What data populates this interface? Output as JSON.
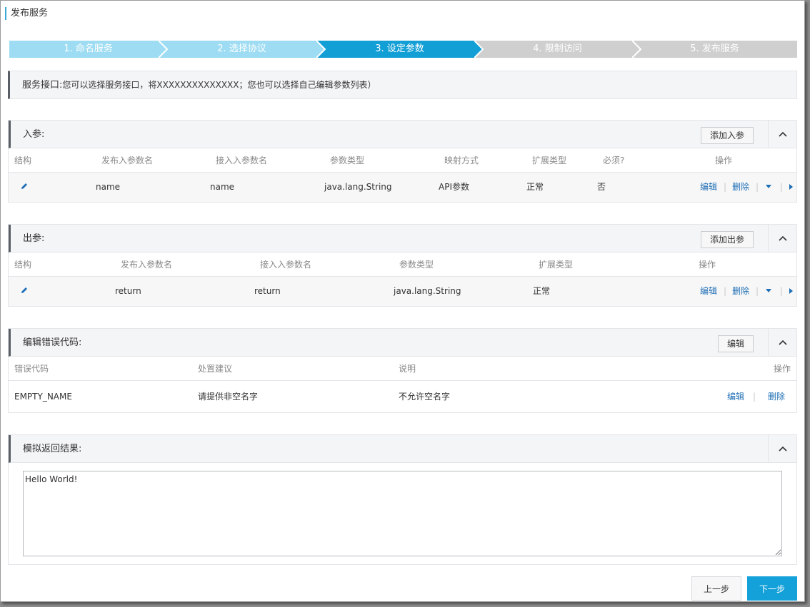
{
  "page_title": "发布服务",
  "steps": [
    {
      "label": "1. 命名服务",
      "state": "done"
    },
    {
      "label": "2. 选择协议",
      "state": "done"
    },
    {
      "label": "3. 设定参数",
      "state": "active"
    },
    {
      "label": "4. 限制访问",
      "state": "todo"
    },
    {
      "label": "5. 发布服务",
      "state": "todo"
    }
  ],
  "info": {
    "label": "服务接口:",
    "text": "您可以选择服务接口，将XXXXXXXXXXXXXX；您也可以选择自己编辑参数列表）"
  },
  "input_params": {
    "title": "入参:",
    "add_button": "添加入参",
    "columns": [
      "结构",
      "发布入参数名",
      "接入入参数名",
      "参数类型",
      "映射方式",
      "扩展类型",
      "必须?",
      "操作"
    ],
    "rows": [
      {
        "publish_name": "name",
        "access_name": "name",
        "type": "java.lang.String",
        "mapping": "API参数",
        "ext_type": "正常",
        "required": "否",
        "edit": "编辑",
        "delete": "删除"
      }
    ]
  },
  "output_params": {
    "title": "出参:",
    "add_button": "添加出参",
    "columns": [
      "结构",
      "发布入参数名",
      "接入入参数名",
      "参数类型",
      "扩展类型",
      "操作"
    ],
    "rows": [
      {
        "publish_name": "return",
        "access_name": "return",
        "type": "java.lang.String",
        "ext_type": "正常",
        "edit": "编辑",
        "delete": "删除"
      }
    ]
  },
  "error_codes": {
    "title": "编辑错误代码:",
    "edit_button": "编辑",
    "columns": [
      "错误代码",
      "处置建议",
      "说明",
      "操作"
    ],
    "rows": [
      {
        "code": "EMPTY_NAME",
        "advice": "请提供非空名字",
        "desc": "不允许空名字",
        "edit": "编辑",
        "delete": "删除"
      }
    ]
  },
  "mock_result": {
    "title": "模拟返回结果:",
    "value": "Hello World!"
  },
  "footer": {
    "prev": "上一步",
    "next": "下一步"
  },
  "colors": {
    "step_done": "#9ddcf2",
    "step_active": "#129fd6",
    "step_todo": "#cfcfcf",
    "link": "#1f6fb5",
    "primary": "#14a1d9"
  }
}
